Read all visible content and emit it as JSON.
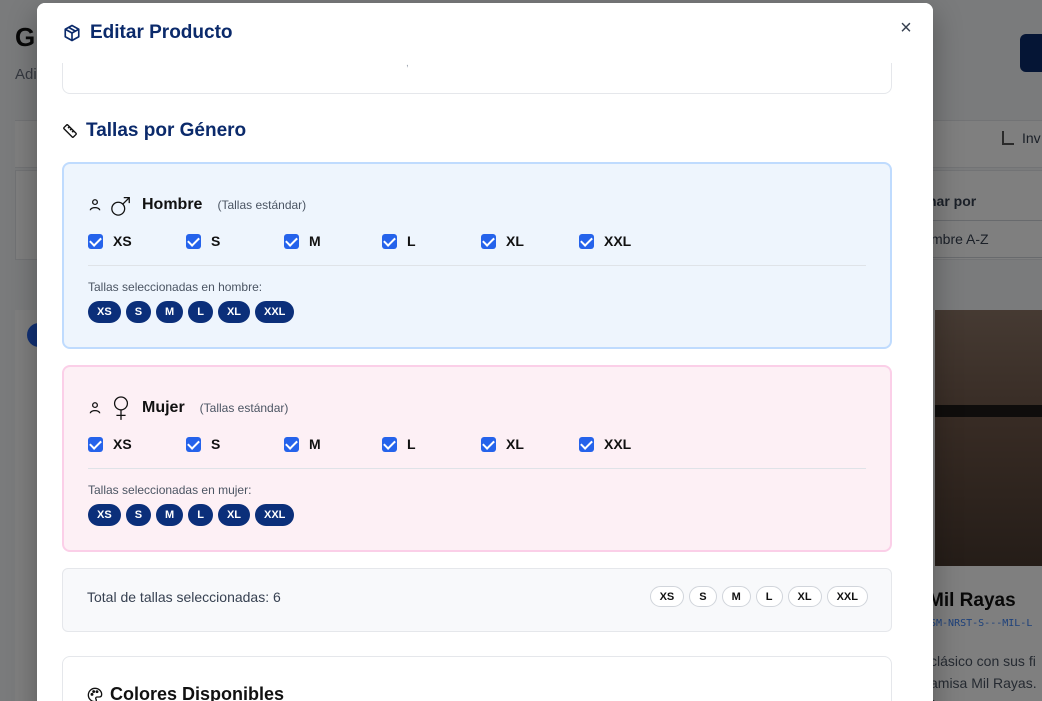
{
  "background": {
    "title": "G",
    "subtitle": "Adi",
    "inventory_label": "Inv",
    "sort_label": "nar por",
    "sort_value": "mbre A-Z",
    "product_title": "Mil Rayas",
    "product_sku": "SM-NRST-S---MIL-L",
    "product_desc_1": "clásico con sus fi",
    "product_desc_2": "amisa Mil Rayas. ("
  },
  "modal": {
    "title": "Editar Producto",
    "close": "×"
  },
  "previous_section": {
    "fragment": ","
  },
  "sizes_section": {
    "title": "Tallas por Género",
    "male": {
      "name": "Hombre",
      "note": "(Tallas estándar)",
      "options": [
        {
          "label": "XS",
          "checked": true
        },
        {
          "label": "S",
          "checked": true
        },
        {
          "label": "M",
          "checked": true
        },
        {
          "label": "L",
          "checked": true
        },
        {
          "label": "XL",
          "checked": true
        },
        {
          "label": "XXL",
          "checked": true
        }
      ],
      "selected_label": "Tallas seleccionadas en hombre:",
      "selected": [
        "XS",
        "S",
        "M",
        "L",
        "XL",
        "XXL"
      ],
      "colors": {
        "bg": "#eef5fd",
        "border": "#bfdbfe"
      }
    },
    "female": {
      "name": "Mujer",
      "note": "(Tallas estándar)",
      "options": [
        {
          "label": "XS",
          "checked": true
        },
        {
          "label": "S",
          "checked": true
        },
        {
          "label": "M",
          "checked": true
        },
        {
          "label": "L",
          "checked": true
        },
        {
          "label": "XL",
          "checked": true
        },
        {
          "label": "XXL",
          "checked": true
        }
      ],
      "selected_label": "Tallas seleccionadas en mujer:",
      "selected": [
        "XS",
        "S",
        "M",
        "L",
        "XL",
        "XXL"
      ],
      "colors": {
        "bg": "#fdf0f5",
        "border": "#fbcfe8"
      }
    },
    "total_label": "Total de tallas seleccionadas: 6",
    "total_sizes": [
      "XS",
      "S",
      "M",
      "L",
      "XL",
      "XXL"
    ]
  },
  "colors_section": {
    "title": "Colores Disponibles"
  },
  "theme": {
    "accent": "#2563eb",
    "navy": "#0b2a6b"
  }
}
